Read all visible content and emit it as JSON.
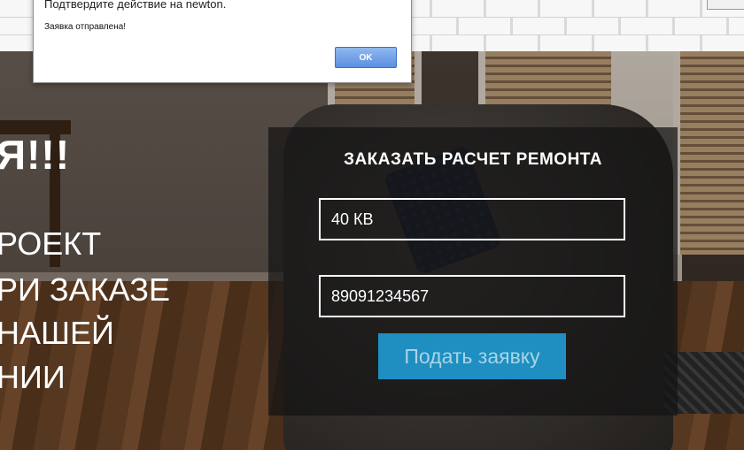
{
  "dialog": {
    "title": "Подтвердите действие на newton.",
    "message": "Заявка отправлена!",
    "ok_label": "OK"
  },
  "hero": {
    "headline": "Я!!!",
    "lines": [
      "РОЕКТ",
      "РИ ЗАКАЗЕ",
      " НАШЕЙ",
      "НИИ"
    ]
  },
  "form": {
    "title": "ЗАКАЗАТЬ РАСЧЕТ РЕМОНТА",
    "area_value": "40 КВ",
    "phone_value": "89091234567",
    "submit_label": "Подать заявку"
  },
  "colors": {
    "button": "#1e8fc0",
    "panel": "rgba(20,20,20,0.72)",
    "text": "#ffffff"
  }
}
